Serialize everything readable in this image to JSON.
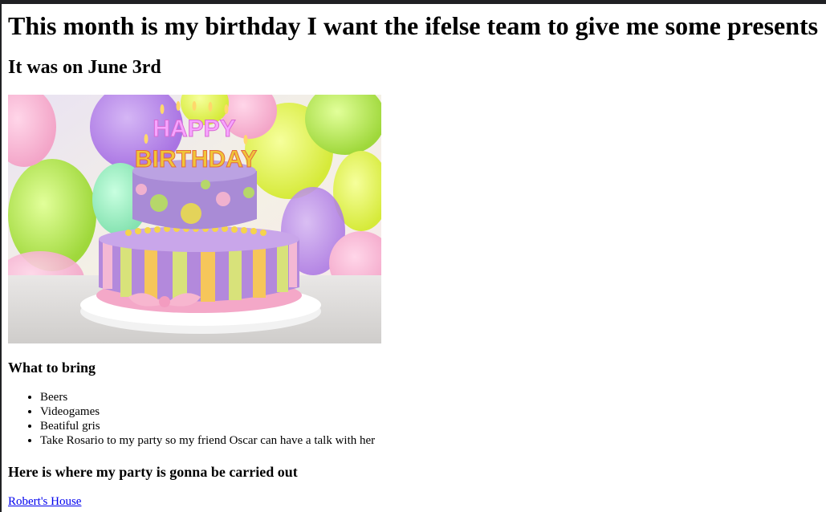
{
  "page": {
    "title": "This month is my birthday I want the ifelse team to give me some presents",
    "date_heading": "It was on June 3rd",
    "image": {
      "icon": "birthday-cake-image",
      "text_top": "HAPPY",
      "text_bottom": "BIRTHDAY"
    },
    "bring_heading": "What to bring",
    "bring_items": [
      "Beers",
      "Videogames",
      "Beatiful gris",
      "Take Rosario to my party so my friend Oscar can have a talk with her"
    ],
    "party_heading": "Here is where my party is gonna be carried out",
    "party_link": "Robert's House"
  },
  "colors": {
    "link": "#0000ee",
    "topbar": "#202124"
  }
}
